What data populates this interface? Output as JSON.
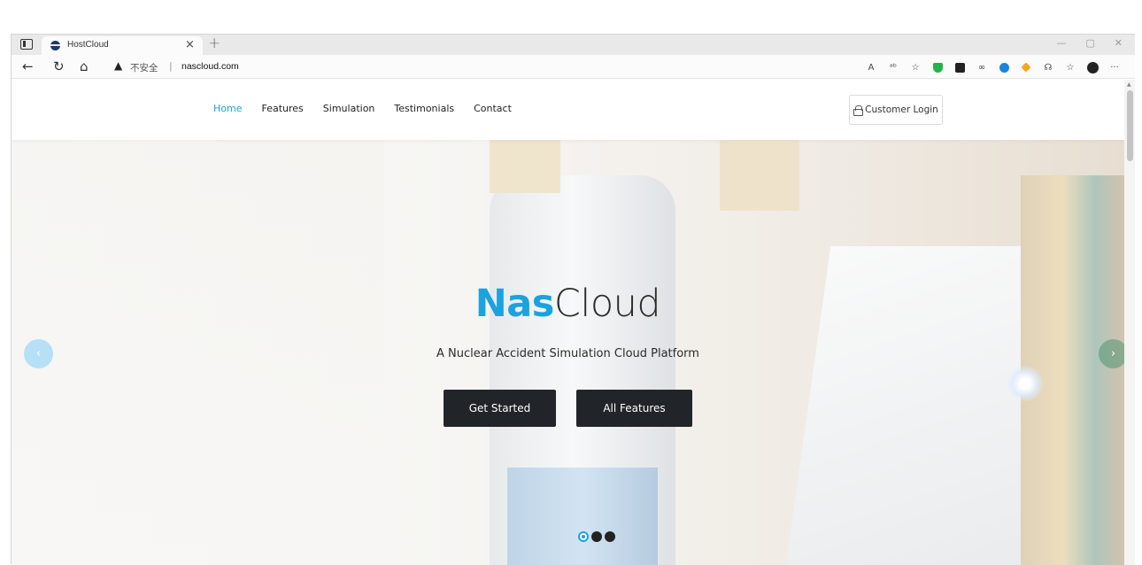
{
  "browser": {
    "tab_title": "HostCloud",
    "tab_close": "×",
    "new_tab": "+",
    "win_min": "—",
    "win_max": "▢",
    "win_close": "✕",
    "address_warning": "▲",
    "address_insecure": "不安全",
    "address_separator": "|",
    "address_url": "nascloud.com",
    "back_glyph": "←",
    "reload_glyph": "↻",
    "home_glyph": "⌂",
    "read_aloud": "A",
    "translate": "ᵃᵇ",
    "favorite_add": "☆",
    "more": "···"
  },
  "site": {
    "nav": [
      {
        "label": "Home",
        "active": true
      },
      {
        "label": "Features",
        "active": false
      },
      {
        "label": "Simulation",
        "active": false
      },
      {
        "label": "Testimonials",
        "active": false
      },
      {
        "label": "Contact",
        "active": false
      }
    ],
    "login_label": "Customer Login",
    "brand_accent": "#1aa3dd"
  },
  "hero": {
    "title_accent": "Nas",
    "title_rest": "Cloud",
    "subtitle": "A Nuclear Accident Simulation Cloud Platform",
    "primary_button": "Get Started",
    "secondary_button": "All Features",
    "prev_glyph": "‹",
    "next_glyph": "›",
    "slide_count": 3,
    "active_slide": 1
  }
}
